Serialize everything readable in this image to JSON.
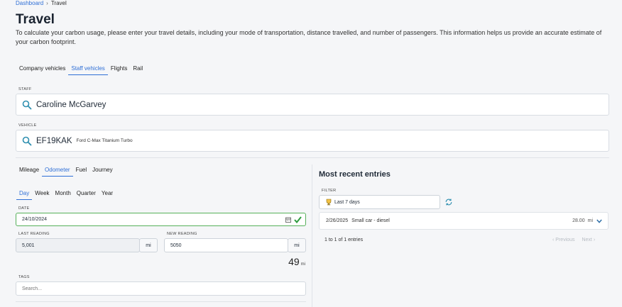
{
  "breadcrumb": {
    "root": "Dashboard",
    "separator": "›",
    "current": "Travel"
  },
  "page": {
    "title": "Travel",
    "intro": "To calculate your carbon usage, please enter your travel details, including your mode of transportation, distance travelled, and number of passengers. This information helps us provide an accurate estimate of your carbon footprint."
  },
  "category_tabs": [
    {
      "label": "Company vehicles",
      "active": false
    },
    {
      "label": "Staff vehicles",
      "active": true
    },
    {
      "label": "Flights",
      "active": false
    },
    {
      "label": "Rail",
      "active": false
    }
  ],
  "staff": {
    "label": "STAFF",
    "value": "Caroline McGarvey"
  },
  "vehicle": {
    "label": "VEHICLE",
    "reg": "EF19KAK",
    "model": "Ford C-Max Titanium Turbo"
  },
  "method_tabs": [
    {
      "label": "Mileage",
      "active": false
    },
    {
      "label": "Odometer",
      "active": true
    },
    {
      "label": "Fuel",
      "active": false
    },
    {
      "label": "Journey",
      "active": false
    }
  ],
  "period_tabs": [
    {
      "label": "Day",
      "active": true
    },
    {
      "label": "Week",
      "active": false
    },
    {
      "label": "Month",
      "active": false
    },
    {
      "label": "Quarter",
      "active": false
    },
    {
      "label": "Year",
      "active": false
    }
  ],
  "date": {
    "label": "DATE",
    "value": "24/10/2024"
  },
  "last_reading": {
    "label": "LAST READING",
    "value": "5,001",
    "unit": "mi"
  },
  "new_reading": {
    "label": "NEW READING",
    "value": "5050",
    "unit": "mi"
  },
  "distance": {
    "value": "49",
    "unit": "mi"
  },
  "tags": {
    "label": "TAGS",
    "placeholder": "Search..."
  },
  "recent": {
    "title": "Most recent entries",
    "filter_label": "FILTER",
    "filter_value": "Last 7 days",
    "entries": [
      {
        "date": "2/26/2025",
        "desc": "Small car - diesel",
        "value": "28.00",
        "unit": "mi"
      }
    ],
    "count": "1 to 1 of 1 entries",
    "prev": "Previous",
    "next": "Next"
  },
  "colors": {
    "accent": "#2f6fd6",
    "success": "#2e9b3e",
    "border_valid": "#56b05a"
  }
}
